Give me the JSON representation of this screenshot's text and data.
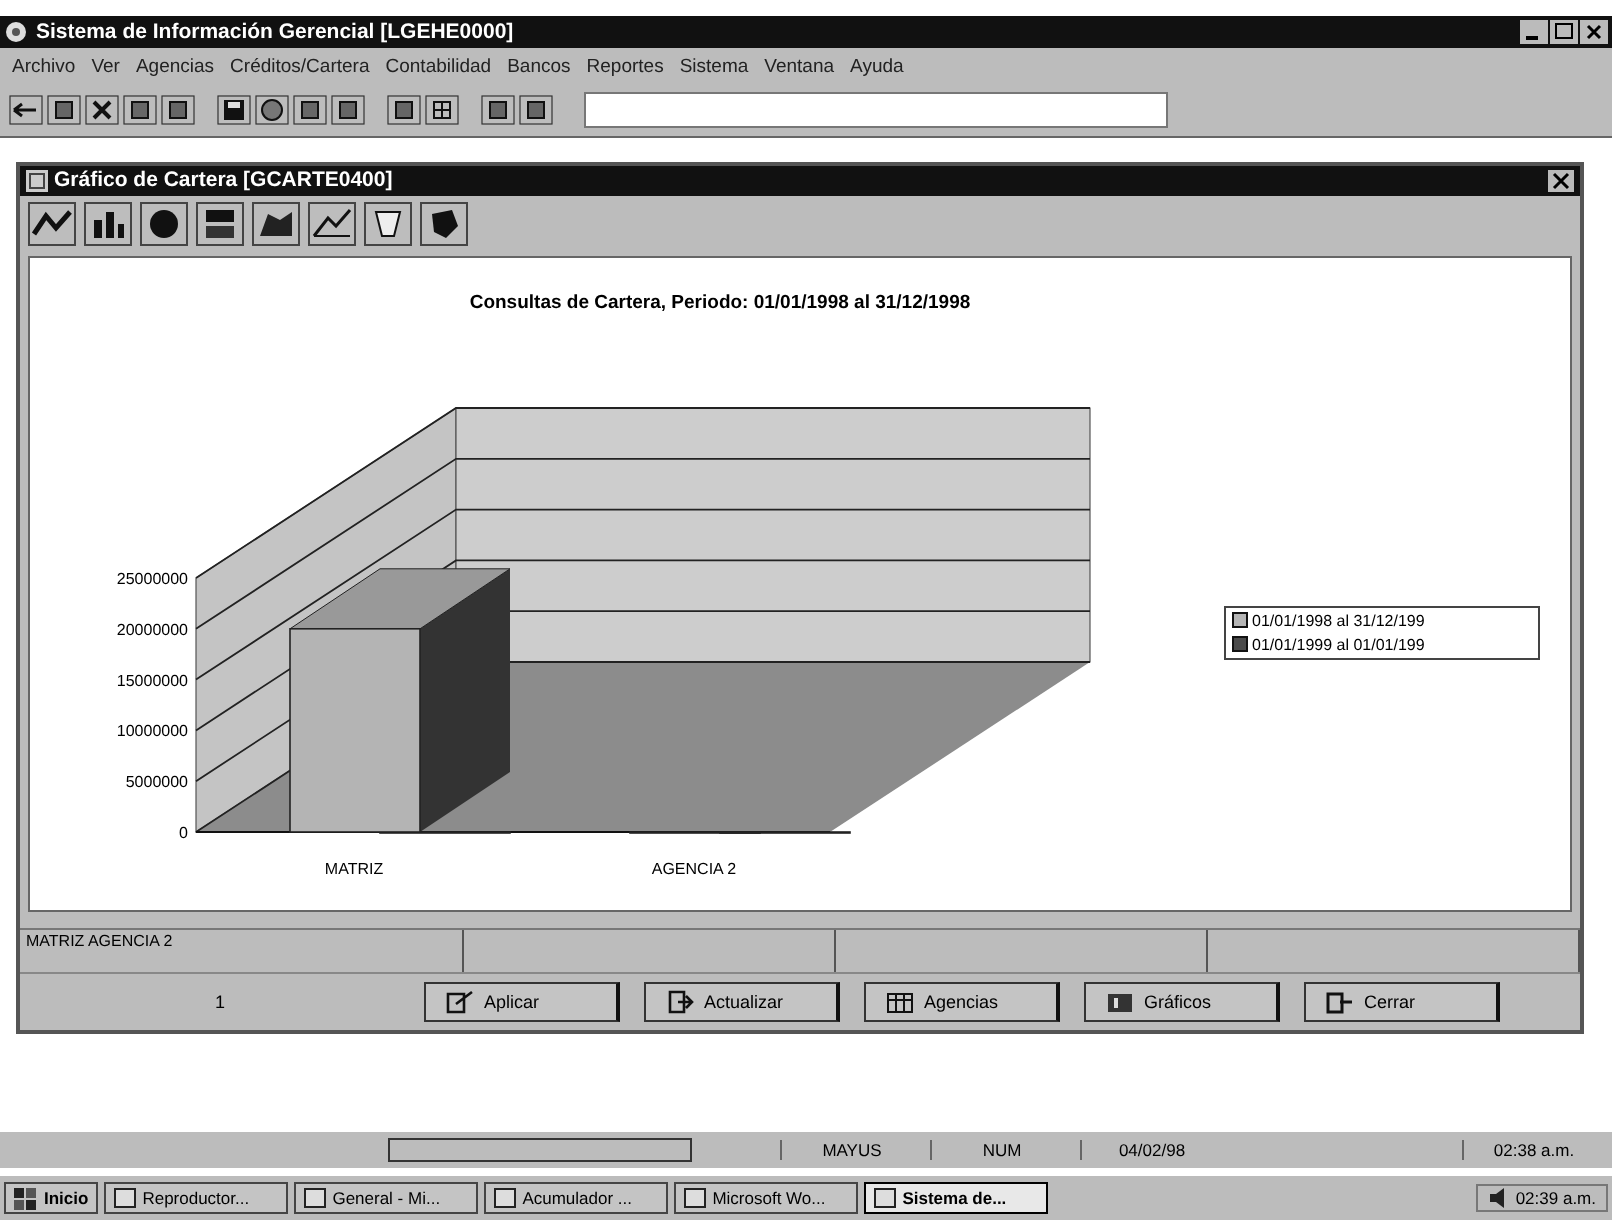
{
  "window": {
    "title": "Sistema de Información Gerencial [LGEHE0000]"
  },
  "menu": [
    "Archivo",
    "Ver",
    "Agencias",
    "Créditos/Cartera",
    "Contabilidad",
    "Bancos",
    "Reportes",
    "Sistema",
    "Ventana",
    "Ayuda"
  ],
  "child_window": {
    "title": "Gráfico de Cartera [GCARTE0400]",
    "chart": {
      "chart_data": {
        "type": "bar",
        "title": "Consultas de Cartera, Periodo: 01/01/1998 al 31/12/1998",
        "categories": [
          "MATRIZ",
          "AGENCIA 2"
        ],
        "series": [
          {
            "name": "01/01/1998 al 31/12/199",
            "color": "#b4b4b4",
            "values": [
              20000000,
              0
            ]
          },
          {
            "name": "01/01/1999 al 01/01/199",
            "color": "#4a4a4a",
            "values": [
              0,
              0
            ]
          }
        ],
        "yticks": [
          0,
          5000000,
          10000000,
          15000000,
          20000000,
          25000000
        ],
        "ylim": [
          0,
          25000000
        ]
      }
    },
    "status_panels": [
      "MATRIZ AGENCIA 2"
    ],
    "page_indicator": "1",
    "buttons": [
      "Aplicar",
      "Actualizar",
      "Agencias",
      "Gráficos",
      "Cerrar"
    ]
  },
  "status_bar": {
    "panels": [
      "MAYUS",
      "NUM",
      "04/02/98",
      "02:38 a.m."
    ]
  },
  "taskbar": {
    "start": "Inicio",
    "tasks": [
      {
        "label": "Reproductor...",
        "selected": false
      },
      {
        "label": "General - Mi...",
        "selected": false
      },
      {
        "label": "Acumulador ...",
        "selected": false
      },
      {
        "label": "Microsoft Wo...",
        "selected": false
      },
      {
        "label": "Sistema de...",
        "selected": true
      }
    ],
    "clock": "02:39 a.m."
  }
}
